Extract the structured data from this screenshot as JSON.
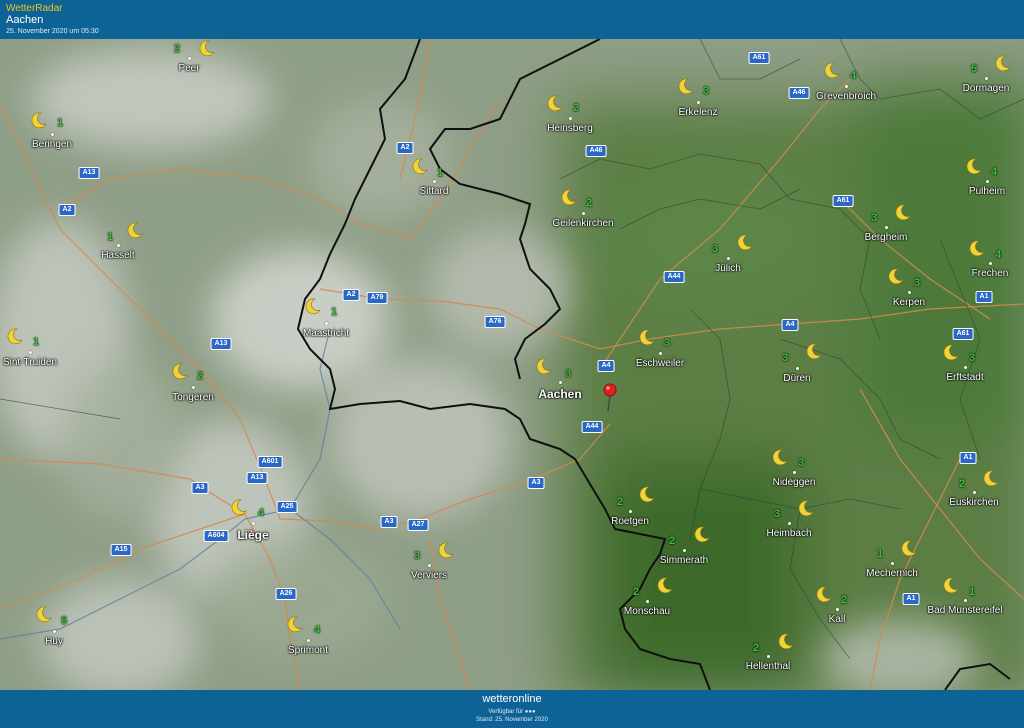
{
  "header": {
    "brand": "WetterRadar",
    "city": "Aachen",
    "timestamp": "25. November 2020 um 05:30"
  },
  "footer": {
    "logo": "wetteronline",
    "available": "Verfügbar für ●●●",
    "stand": "Stand: 25. November 2020"
  },
  "colors": {
    "bar": "#0e6396",
    "accent": "#f0c419",
    "shield": "#2a68c7",
    "number": "#3ec23e"
  },
  "cities": [
    {
      "id": "peer",
      "name": "Peer",
      "num": "2",
      "big": false
    },
    {
      "id": "beringen",
      "name": "Beringen",
      "num": "1",
      "big": false
    },
    {
      "id": "hasselt",
      "name": "Hasselt",
      "num": "1",
      "big": false
    },
    {
      "id": "sint-truiden",
      "name": "Sint-Truiden",
      "num": "1",
      "big": false
    },
    {
      "id": "tongeren",
      "name": "Tongeren",
      "num": "2",
      "big": false
    },
    {
      "id": "maastricht",
      "name": "Maastricht",
      "num": "1",
      "big": false
    },
    {
      "id": "sittard",
      "name": "Sittard",
      "num": "1",
      "big": false
    },
    {
      "id": "liege",
      "name": "Liège",
      "num": "4",
      "big": true
    },
    {
      "id": "huy",
      "name": "Huy",
      "num": "5",
      "big": false
    },
    {
      "id": "sprimont",
      "name": "Sprimont",
      "num": "4",
      "big": false
    },
    {
      "id": "verviers",
      "name": "Verviers",
      "num": "3",
      "big": false
    },
    {
      "id": "heinsberg",
      "name": "Heinsberg",
      "num": "2",
      "big": false
    },
    {
      "id": "geilenkirchen",
      "name": "Geilenkirchen",
      "num": "2",
      "big": false
    },
    {
      "id": "aachen",
      "name": "Aachen",
      "num": "3",
      "big": true
    },
    {
      "id": "erkelenz",
      "name": "Erkelenz",
      "num": "3",
      "big": false
    },
    {
      "id": "grevenbroich",
      "name": "Grevenbroich",
      "num": "4",
      "big": false
    },
    {
      "id": "dormagen",
      "name": "Dormagen",
      "num": "5",
      "big": false
    },
    {
      "id": "pulheim",
      "name": "Pulheim",
      "num": "4",
      "big": false
    },
    {
      "id": "bergheim",
      "name": "Bergheim",
      "num": "3",
      "big": false
    },
    {
      "id": "julich",
      "name": "Jülich",
      "num": "3",
      "big": false
    },
    {
      "id": "frechen",
      "name": "Frechen",
      "num": "4",
      "big": false
    },
    {
      "id": "kerpen",
      "name": "Kerpen",
      "num": "3",
      "big": false
    },
    {
      "id": "eschweiler",
      "name": "Eschweiler",
      "num": "3",
      "big": false
    },
    {
      "id": "duren",
      "name": "Düren",
      "num": "3",
      "big": false
    },
    {
      "id": "erftstadt",
      "name": "Erftstadt",
      "num": "3",
      "big": false
    },
    {
      "id": "nideggen",
      "name": "Nideggen",
      "num": "3",
      "big": false
    },
    {
      "id": "roetgen",
      "name": "Roetgen",
      "num": "2",
      "big": false
    },
    {
      "id": "heimbach",
      "name": "Heimbach",
      "num": "3",
      "big": false
    },
    {
      "id": "simmerath",
      "name": "Simmerath",
      "num": "2",
      "big": false
    },
    {
      "id": "monschau",
      "name": "Monschau",
      "num": "2",
      "big": false
    },
    {
      "id": "euskirchen",
      "name": "Euskirchen",
      "num": "2",
      "big": false
    },
    {
      "id": "mechernich",
      "name": "Mechernich",
      "num": "1",
      "big": false
    },
    {
      "id": "kall",
      "name": "Kall",
      "num": "2",
      "big": false
    },
    {
      "id": "bad-munstereifel",
      "name": "Bad Munstereifel",
      "num": "1",
      "big": false
    },
    {
      "id": "hellenthal",
      "name": "Hellenthal",
      "num": "2",
      "big": false
    }
  ],
  "roads": [
    "A61",
    "A46",
    "A2",
    "A46",
    "A61",
    "A2",
    "A13",
    "A2",
    "A79",
    "A76",
    "A44",
    "A4",
    "A4",
    "A13",
    "A44",
    "A61",
    "A1",
    "A601",
    "A3",
    "A13",
    "A25",
    "A3",
    "A3",
    "A27",
    "A604",
    "A15",
    "A26",
    "A1",
    "A1"
  ]
}
